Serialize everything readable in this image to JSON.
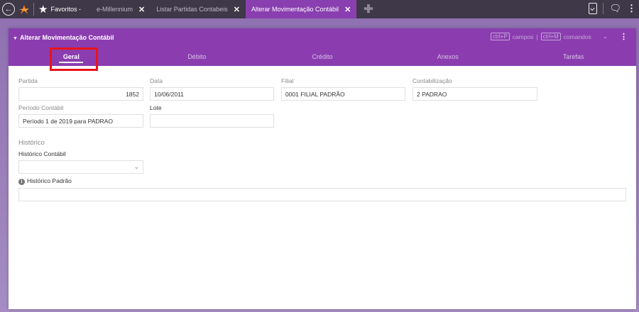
{
  "topbar": {
    "favorites_label": "Favoritos -",
    "tabs": [
      {
        "label": "e-Millennium"
      },
      {
        "label": "Listar Partidas Contabeis"
      },
      {
        "label": "Alterar Movimentação Contábil"
      }
    ]
  },
  "panel": {
    "title": "Alterar Movimentação Contábil",
    "shortcut_campos_key": "ctrl+P",
    "shortcut_campos_label": "campos",
    "shortcut_sep": "|",
    "shortcut_comandos_key": "ctrl+M",
    "shortcut_comandos_label": "comandos",
    "subtabs": [
      {
        "label": "Geral"
      },
      {
        "label": "Débito"
      },
      {
        "label": "Crédito"
      },
      {
        "label": "Anexos"
      },
      {
        "label": "Tarefas"
      }
    ]
  },
  "form": {
    "partida_label": "Partida",
    "partida_value": "1852",
    "data_label": "Data",
    "data_value": "10/06/2011",
    "filial_label": "Filial",
    "filial_value": "0001 FILIAL PADRÃO",
    "contabilizacao_label": "Contabilização",
    "contabilizacao_value": "2 PADRAO",
    "periodo_label": "Período Contábil",
    "periodo_value": "Período 1 de 2019 para PADRAO",
    "lote_label": "Lote",
    "lote_value": "",
    "historico_section": "Histórico",
    "historico_contabil_label": "Histórico Contábil",
    "historico_contabil_value": "",
    "historico_padrao_label": "Histórico Padrão",
    "historico_padrao_value": ""
  },
  "colors": {
    "accent": "#8b3db0",
    "highlight": "#e8141a",
    "topbar": "#3e3848"
  }
}
